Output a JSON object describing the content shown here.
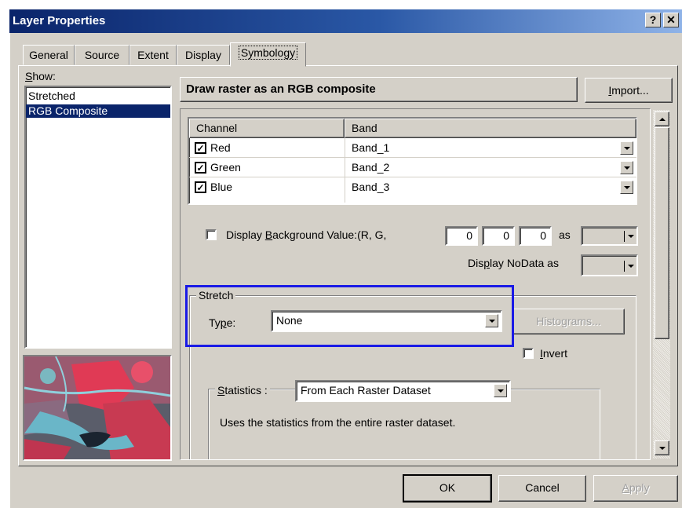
{
  "window": {
    "title": "Layer Properties",
    "help_label": "?",
    "close_label": "✕"
  },
  "tabs": [
    {
      "label": "General"
    },
    {
      "label": "Source"
    },
    {
      "label": "Extent"
    },
    {
      "label": "Display"
    },
    {
      "label": "Symbology"
    }
  ],
  "show": {
    "label_mn": "S",
    "label_rest": "how:",
    "items": [
      {
        "label": "Stretched"
      },
      {
        "label": "RGB Composite"
      }
    ]
  },
  "header": {
    "title": "Draw raster as an RGB composite",
    "import_mn": "I",
    "import_rest": "mport..."
  },
  "table": {
    "col_channel": "Channel",
    "col_band": "Band",
    "rows": [
      {
        "channel": "Red",
        "band": "Band_1",
        "checked": true
      },
      {
        "channel": "Green",
        "band": "Band_2",
        "checked": true
      },
      {
        "channel": "Blue",
        "band": "Band_3",
        "checked": true
      }
    ]
  },
  "background": {
    "pre": "Display ",
    "mn": "B",
    "post": "ackground Value:(R, G,",
    "r": "0",
    "g": "0",
    "b": "0",
    "as_label": "as",
    "checked": false
  },
  "nodata": {
    "pre": "Dis",
    "mn": "p",
    "post": "lay NoData as"
  },
  "stretch": {
    "legend": "Stretch",
    "type_pre": "Ty",
    "type_mn": "p",
    "type_post": "e:",
    "type_value": "None",
    "histograms_label": "Histograms...",
    "invert_mn": "I",
    "invert_rest": "nvert",
    "statistics_mn": "S",
    "statistics_rest": "tatistics :",
    "statistics_value": "From Each Raster Dataset",
    "statistics_desc": "Uses the statistics from the entire raster dataset."
  },
  "footer": {
    "ok_label": "OK",
    "cancel_label": "Cancel",
    "apply_mn": "A",
    "apply_rest": "pply"
  },
  "colors": {
    "highlight": "#0a246a",
    "annotation_box": "#1a1ae6",
    "face": "#d4d0c8"
  }
}
